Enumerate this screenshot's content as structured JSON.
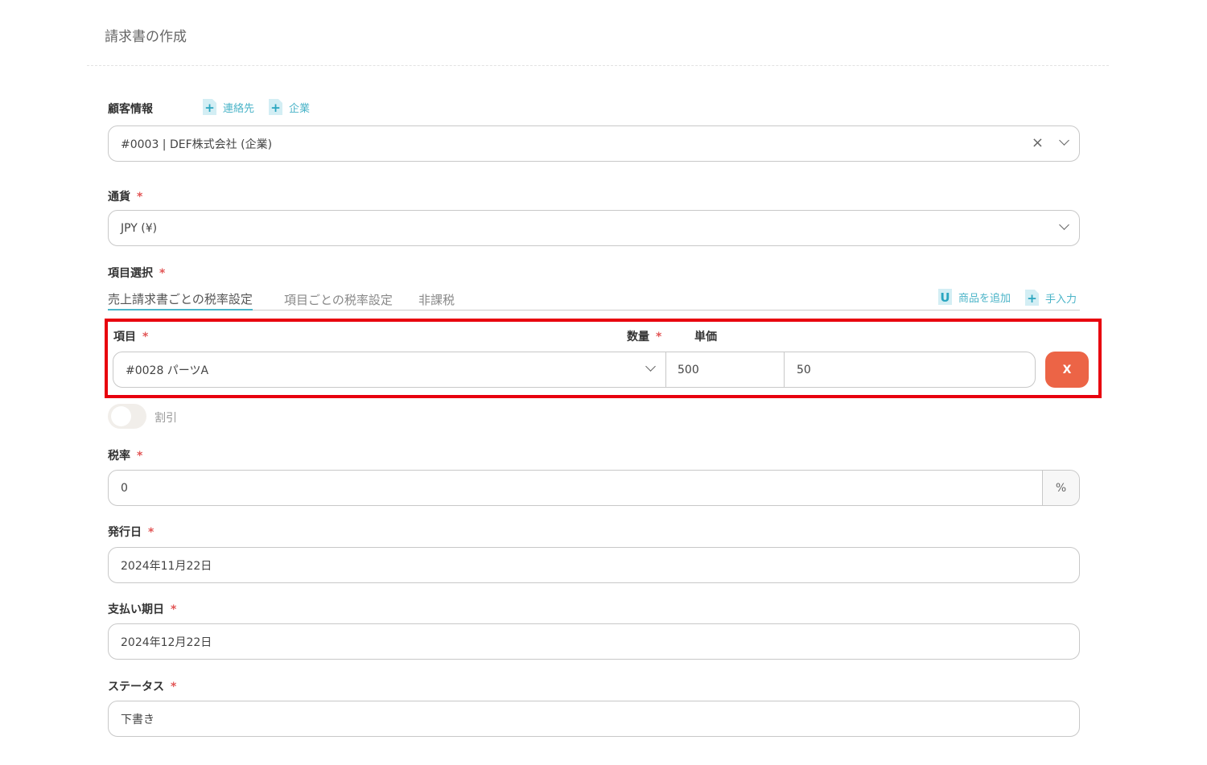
{
  "title": "請求書の作成",
  "customer": {
    "label": "顧客情報",
    "add_contact": "連絡先",
    "add_company": "企業",
    "value": "#0003 | DEF株式会社 (企業)"
  },
  "currency": {
    "label": "通貨",
    "required": "*",
    "value": "JPY (¥)"
  },
  "items": {
    "label": "項目選択",
    "required": "*",
    "tabs": [
      "売上請求書ごとの税率設定",
      "項目ごとの税率設定",
      "非課税"
    ],
    "add_product": "商品を追加",
    "manual": "手入力",
    "col_item": "項目",
    "col_qty": "数量",
    "col_price": "単価",
    "row": {
      "item": "#0028 パーツA",
      "qty": "500",
      "price": "50",
      "remove": "X"
    },
    "discount_label": "割引"
  },
  "tax": {
    "label": "税率",
    "value": "0",
    "unit": "%"
  },
  "issue_date": {
    "label": "発行日",
    "value": "2024年11月22日"
  },
  "due_date": {
    "label": "支払い期日",
    "value": "2024年12月22日"
  },
  "status": {
    "label": "ステータス",
    "value": "下書き"
  },
  "colors": {
    "accent": "#4bb4c8",
    "remove": "#ec6446",
    "highlight": "#e8000e"
  }
}
